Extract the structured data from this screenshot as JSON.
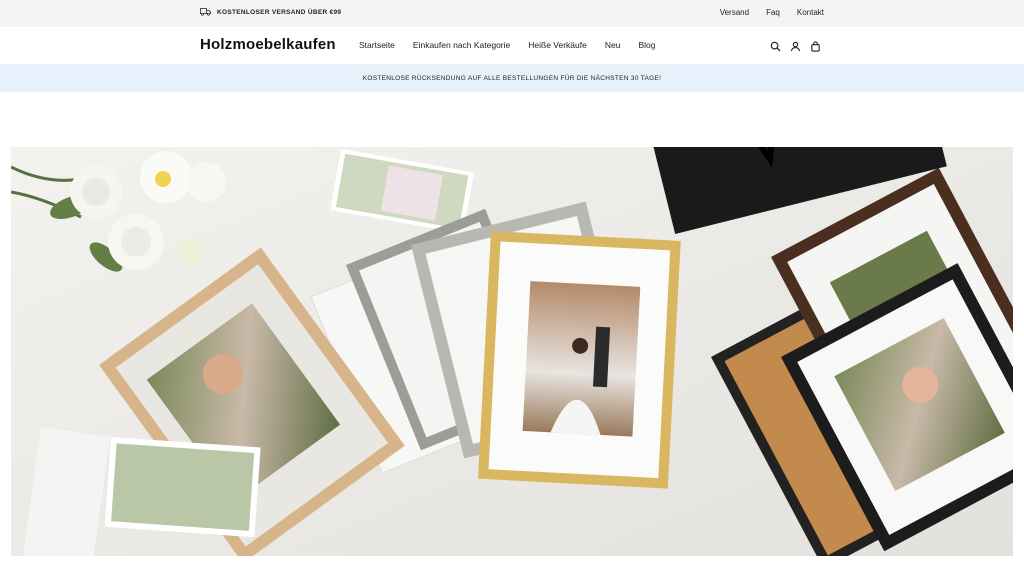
{
  "topbar": {
    "promo_text": "KOSTENLOSER VERSAND ÜBER €99",
    "promo_icon": "truck-icon",
    "links": [
      {
        "label": "Versand"
      },
      {
        "label": "Faq"
      },
      {
        "label": "Kontakt"
      }
    ]
  },
  "header": {
    "logo": "Holzmoebelkaufen",
    "nav": [
      {
        "label": "Startseite"
      },
      {
        "label": "Einkaufen nach Kategorie"
      },
      {
        "label": "Heiße Verkäufe"
      },
      {
        "label": "Neu"
      },
      {
        "label": "Blog"
      }
    ],
    "icons": [
      "search-icon",
      "user-icon",
      "cart-icon"
    ]
  },
  "announcement": {
    "text": "KOSTENLOSE RÜCKSENDUNG AUF ALLE BESTELLUNGEN FÜR DIE NÄCHSTEN 30 TAGE!"
  },
  "hero": {
    "image": "picture-frames-product-photo"
  },
  "colors": {
    "topbar_bg": "#f4f4f4",
    "announcement_bg": "#e6f1fb",
    "text": "#1a1a1a"
  }
}
